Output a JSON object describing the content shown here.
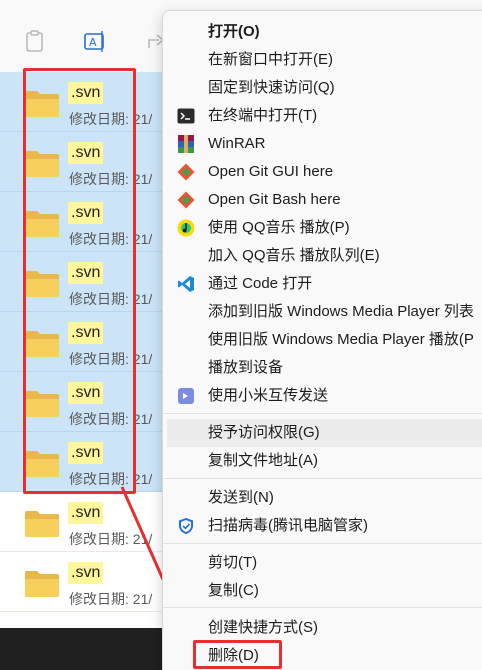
{
  "files": [
    {
      "name": ".svn",
      "modified_label": "修改日期: 21/",
      "selected": true
    },
    {
      "name": ".svn",
      "modified_label": "修改日期: 21/",
      "selected": true
    },
    {
      "name": ".svn",
      "modified_label": "修改日期: 21/",
      "selected": true
    },
    {
      "name": ".svn",
      "modified_label": "修改日期: 21/",
      "selected": true
    },
    {
      "name": ".svn",
      "modified_label": "修改日期: 21/",
      "selected": true
    },
    {
      "name": ".svn",
      "modified_label": "修改日期: 21/",
      "selected": true
    },
    {
      "name": ".svn",
      "modified_label": "修改日期: 21/",
      "selected": true
    },
    {
      "name": ".svn",
      "modified_label": "修改日期: 21/",
      "selected": false
    },
    {
      "name": ".svn",
      "modified_label": "修改日期: 21/",
      "selected": false
    }
  ],
  "context_menu": {
    "items": [
      {
        "label": "打开(O)",
        "icon": "none"
      },
      {
        "label": "在新窗口中打开(E)",
        "icon": "none"
      },
      {
        "label": "固定到快速访问(Q)",
        "icon": "none"
      },
      {
        "label": "在终端中打开(T)",
        "icon": "terminal-icon"
      },
      {
        "label": "WinRAR",
        "icon": "winrar-icon"
      },
      {
        "label": "Open Git GUI here",
        "icon": "git-gui-icon"
      },
      {
        "label": "Open Git Bash here",
        "icon": "git-bash-icon"
      },
      {
        "label": "使用 QQ音乐 播放(P)",
        "icon": "qq-music-icon"
      },
      {
        "label": "加入 QQ音乐 播放队列(E)",
        "icon": "none"
      },
      {
        "label": "通过 Code 打开",
        "icon": "vscode-icon"
      },
      {
        "label": "添加到旧版 Windows Media Player 列表",
        "icon": "none"
      },
      {
        "label": "使用旧版 Windows Media Player 播放(P",
        "icon": "none"
      },
      {
        "label": "播放到设备",
        "icon": "none"
      },
      {
        "label": "使用小米互传发送",
        "icon": "xiaomi-share-icon"
      },
      {
        "label": "授予访问权限(G)",
        "icon": "none"
      },
      {
        "label": "复制文件地址(A)",
        "icon": "none"
      },
      {
        "label": "发送到(N)",
        "icon": "none"
      },
      {
        "label": "扫描病毒(腾讯电脑管家)",
        "icon": "tencent-shield-icon"
      },
      {
        "label": "剪切(T)",
        "icon": "none"
      },
      {
        "label": "复制(C)",
        "icon": "none"
      },
      {
        "label": "创建快捷方式(S)",
        "icon": "none"
      },
      {
        "label": "删除(D)",
        "icon": "none"
      }
    ]
  },
  "colors": {
    "selection": "#cce4f7",
    "annotation": "#e53030",
    "name_highlight": "#fff79a"
  }
}
